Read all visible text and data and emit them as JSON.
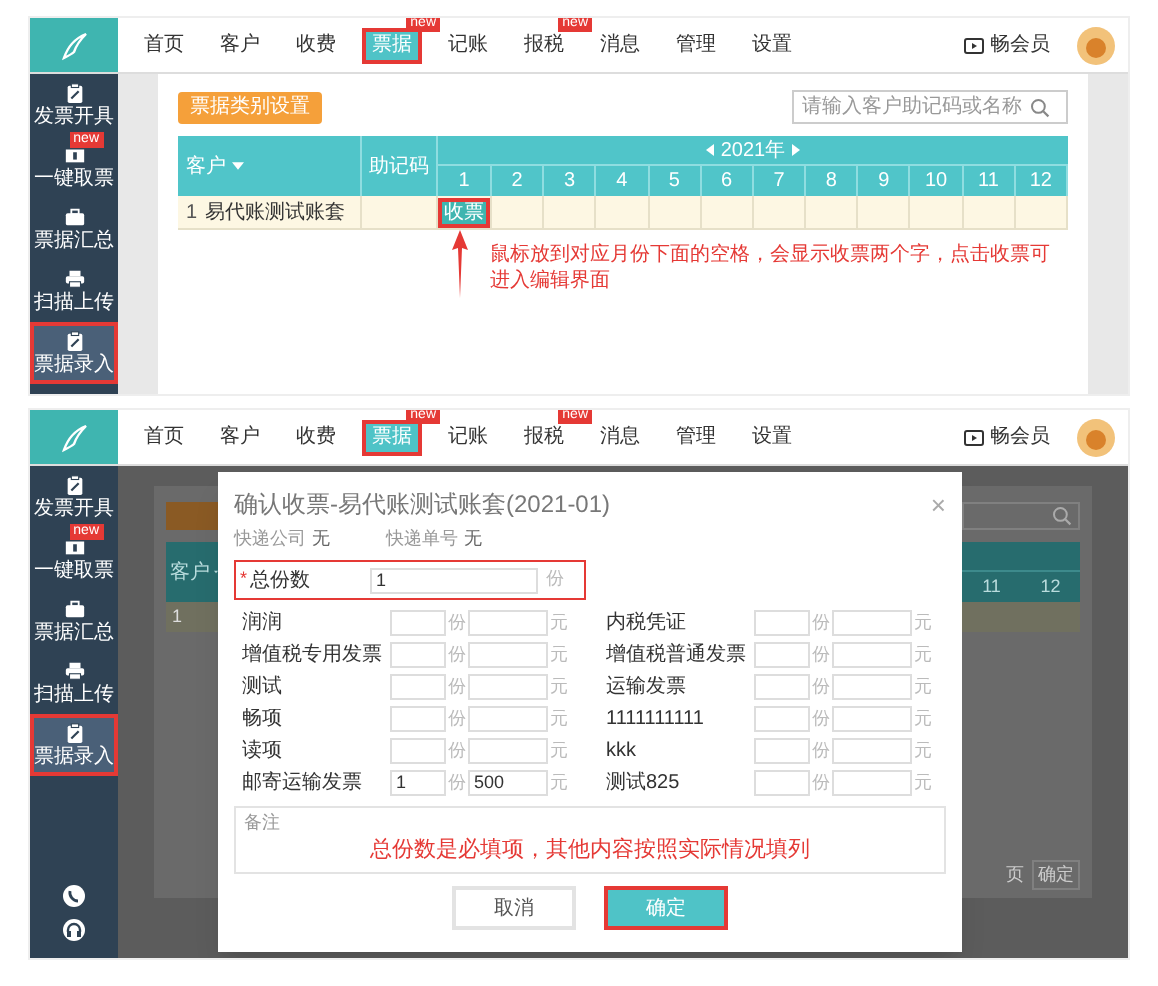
{
  "screens": [
    {
      "kind": "table",
      "nav": {
        "items": [
          {
            "label": "首页",
            "selected": false,
            "highlighted": false
          },
          {
            "label": "客户",
            "selected": false,
            "highlighted": false
          },
          {
            "label": "收费",
            "selected": false,
            "highlighted": false
          },
          {
            "label": "票据",
            "selected": true,
            "highlighted": true,
            "badge": "new"
          },
          {
            "label": "记账",
            "selected": false,
            "highlighted": false
          },
          {
            "label": "报税",
            "selected": false,
            "highlighted": false,
            "badge": "new"
          },
          {
            "label": "消息",
            "selected": false,
            "highlighted": false
          },
          {
            "label": "管理",
            "selected": false,
            "highlighted": false
          },
          {
            "label": "设置",
            "selected": false,
            "highlighted": false
          }
        ]
      },
      "user": {
        "label": "畅会员"
      },
      "sidebar": {
        "items": [
          {
            "label": "发票开具",
            "selected": false,
            "highlighted": false
          },
          {
            "label": "一键取票",
            "selected": false,
            "highlighted": false,
            "badge": "new"
          },
          {
            "label": "票据汇总",
            "selected": false,
            "highlighted": false
          },
          {
            "label": "扫描上传",
            "selected": false,
            "highlighted": false
          },
          {
            "label": "票据录入",
            "selected": true,
            "highlighted": true
          }
        ]
      },
      "toolbar_button": "票据类别设置",
      "search": {
        "placeholder": "请输入客户助记码或名称"
      },
      "table": {
        "columns": [
          "客户",
          "助记码"
        ],
        "year": "2021年",
        "months": [
          "1",
          "2",
          "3",
          "4",
          "5",
          "6",
          "7",
          "8",
          "9",
          "10",
          "11",
          "12"
        ],
        "rows": [
          {
            "index": "1",
            "name": "易代账测试账套",
            "cells": [
              {
                "kind": "button",
                "label": "收票",
                "highlighted": true
              },
              {
                "kind": "empty"
              },
              {
                "kind": "empty"
              },
              {
                "kind": "empty"
              },
              {
                "kind": "empty"
              },
              {
                "kind": "empty"
              },
              {
                "kind": "empty"
              },
              {
                "kind": "empty"
              },
              {
                "kind": "empty"
              },
              {
                "kind": "empty"
              },
              {
                "kind": "empty"
              },
              {
                "kind": "empty"
              }
            ]
          }
        ]
      },
      "annotation": "鼠标放到对应月份下面的空格，会显示收票两个字，点击收票可进入编辑界面"
    },
    {
      "kind": "dialog",
      "nav": {
        "items": [
          {
            "label": "首页",
            "selected": false,
            "highlighted": false
          },
          {
            "label": "客户",
            "selected": false,
            "highlighted": false
          },
          {
            "label": "收费",
            "selected": false,
            "highlighted": false
          },
          {
            "label": "票据",
            "selected": true,
            "highlighted": true,
            "badge": "new"
          },
          {
            "label": "记账",
            "selected": false,
            "highlighted": false
          },
          {
            "label": "报税",
            "selected": false,
            "highlighted": false,
            "badge": "new"
          },
          {
            "label": "消息",
            "selected": false,
            "highlighted": false
          },
          {
            "label": "管理",
            "selected": false,
            "highlighted": false
          },
          {
            "label": "设置",
            "selected": false,
            "highlighted": false
          }
        ]
      },
      "user": {
        "label": "畅会员"
      },
      "sidebar": {
        "items": [
          {
            "label": "发票开具",
            "selected": false,
            "highlighted": false
          },
          {
            "label": "一键取票",
            "selected": false,
            "highlighted": false,
            "badge": "new"
          },
          {
            "label": "票据汇总",
            "selected": false,
            "highlighted": false
          },
          {
            "label": "扫描上传",
            "selected": false,
            "highlighted": false
          },
          {
            "label": "票据录入",
            "selected": true,
            "highlighted": true
          }
        ]
      },
      "background": {
        "column": "客户",
        "row_index": "1",
        "months": [
          "11",
          "12"
        ],
        "pager": [
          "页",
          "确定"
        ]
      },
      "dialog": {
        "title": "确认收票-易代账测试账套(2021-01)",
        "close": "×",
        "express": [
          {
            "label": "快递公司",
            "value": "无"
          },
          {
            "label": "快递单号",
            "value": "无"
          }
        ],
        "total": {
          "required_mark": "*",
          "label": "总份数",
          "value": "1",
          "unit": "份",
          "highlighted": true
        },
        "items": [
          {
            "label": "润润",
            "count_unit": "份",
            "amount_unit": "元"
          },
          {
            "label": "内税凭证",
            "count_unit": "份",
            "amount_unit": "元"
          },
          {
            "label": "增值税专用发票",
            "count_unit": "份",
            "amount_unit": "元"
          },
          {
            "label": "增值税普通发票",
            "count_unit": "份",
            "amount_unit": "元"
          },
          {
            "label": "测试",
            "count_unit": "份",
            "amount_unit": "元"
          },
          {
            "label": "运输发票",
            "count_unit": "份",
            "amount_unit": "元"
          },
          {
            "label": "畅项",
            "count_unit": "份",
            "amount_unit": "元"
          },
          {
            "label": "1111111111",
            "count_unit": "份",
            "amount_unit": "元"
          },
          {
            "label": "读项",
            "count_unit": "份",
            "amount_unit": "元"
          },
          {
            "label": "kkk",
            "count_unit": "份",
            "amount_unit": "元"
          },
          {
            "label": "邮寄运输发票",
            "count": "1",
            "count_unit": "份",
            "amount": "500",
            "amount_unit": "元"
          },
          {
            "label": "测试825",
            "count_unit": "份",
            "amount_unit": "元"
          }
        ],
        "remark": {
          "placeholder": "备注"
        },
        "annotation": "总份数是必填项，其他内容按照实际情况填列",
        "buttons": [
          {
            "label": "取消",
            "kind": "secondary",
            "highlighted": false
          },
          {
            "label": "确定",
            "kind": "primary",
            "highlighted": true
          }
        ]
      }
    }
  ]
}
